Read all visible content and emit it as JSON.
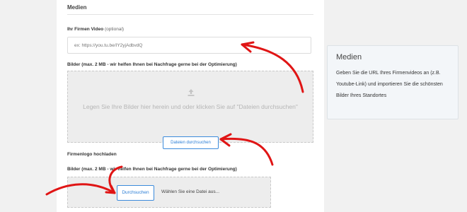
{
  "form": {
    "section_title": "Medien",
    "video_label": "Ihr Firmen Video",
    "video_optional": "(optional)",
    "video_placeholder": "ex: https://you.tu.be/IY2yjAdbvdQ",
    "images_label": "Bilder (max. 2 MB - wir helfen Ihnen bei Nachfrage gerne bei der Optimierung)",
    "dropzone_text": "Legen Sie Ihre Bilder hier herein und oder klicken Sie auf \"Dateien durchsuchen\"",
    "browse_files_button": "Dateien durchsuchen",
    "logo_label": "Firmenlogo hochladen",
    "logo_images_label": "Bilder (max. 2 MB - wir helfen Ihnen bei Nachfrage gerne bei der Optimierung)",
    "browse_button": "Durchsuchen",
    "file_status": "Wählen Sie eine Datei aus..."
  },
  "sidebar": {
    "title": "Medien",
    "description": "Geben Sie die URL Ihres Firmenvideos an (z.B. Youtube-Link) und importieren Sie die schönsten Bilder Ihres Standortes"
  },
  "icons": {
    "upload": "upload-icon",
    "annotation": "red-arrow-icon"
  },
  "colors": {
    "accent_blue": "#2b7ed6",
    "annotation_red": "#e01515",
    "page_bg": "#f1f1f1",
    "dropzone_bg": "#ededed"
  }
}
